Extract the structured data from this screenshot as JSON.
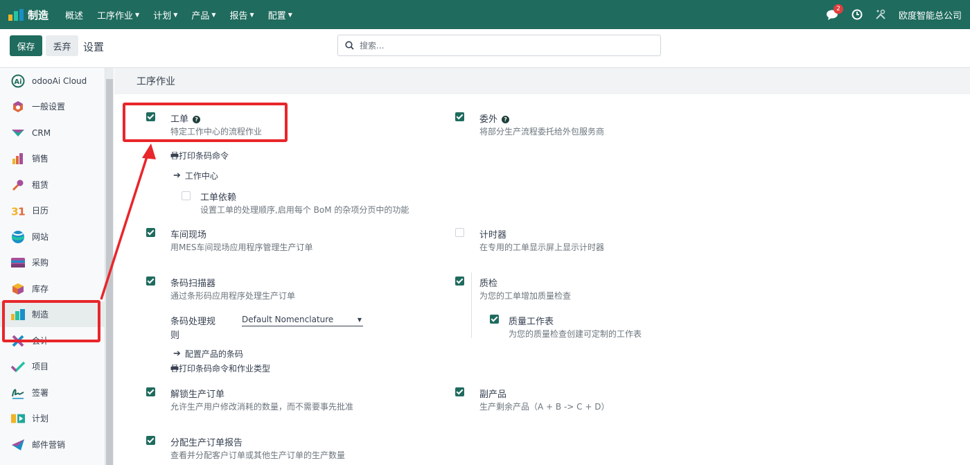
{
  "navbar": {
    "app_name": "制造",
    "menu": [
      {
        "label": "概述",
        "dropdown": false
      },
      {
        "label": "工序作业",
        "dropdown": true
      },
      {
        "label": "计划",
        "dropdown": true
      },
      {
        "label": "产品",
        "dropdown": true
      },
      {
        "label": "报告",
        "dropdown": true
      },
      {
        "label": "配置",
        "dropdown": true
      }
    ],
    "messages_count": "2",
    "company": "欧度智能总公司",
    "brand_color": "#1f6b5e"
  },
  "toolbar": {
    "save_label": "保存",
    "discard_label": "丢弃",
    "title": "设置"
  },
  "search": {
    "placeholder": "搜索..."
  },
  "sidebar": {
    "items": [
      {
        "label": "odooAi Cloud",
        "icon": "ai-cloud-icon"
      },
      {
        "label": "一般设置",
        "icon": "general-settings-icon"
      },
      {
        "label": "CRM",
        "icon": "crm-icon"
      },
      {
        "label": "销售",
        "icon": "sales-icon"
      },
      {
        "label": "租赁",
        "icon": "rental-icon"
      },
      {
        "label": "日历",
        "icon": "calendar-icon"
      },
      {
        "label": "网站",
        "icon": "website-icon"
      },
      {
        "label": "采购",
        "icon": "purchase-icon"
      },
      {
        "label": "库存",
        "icon": "inventory-icon"
      },
      {
        "label": "制造",
        "icon": "manufacturing-icon",
        "active": true
      },
      {
        "label": "会计",
        "icon": "accounting-icon"
      },
      {
        "label": "项目",
        "icon": "project-icon"
      },
      {
        "label": "签署",
        "icon": "sign-icon"
      },
      {
        "label": "计划",
        "icon": "planning-icon"
      },
      {
        "label": "邮件营销",
        "icon": "email-marketing-icon"
      }
    ]
  },
  "section": {
    "title": "工序作业"
  },
  "settings": {
    "work_orders": {
      "title": "工单",
      "desc": "特定工作中心的流程作业",
      "checked": true
    },
    "print_barcode": "打印条码命令",
    "work_centers_link": "工作中心",
    "wo_dependencies": {
      "title": "工单依赖",
      "desc": "设置工单的处理顺序,启用每个 BoM 的杂项分页中的功能",
      "checked": false
    },
    "subcontracting": {
      "title": "委外",
      "desc": "将部分生产流程委托给外包服务商",
      "checked": true
    },
    "shop_floor": {
      "title": "车间现场",
      "desc": "用MES车间现场应用程序管理生产订单",
      "checked": true
    },
    "timer": {
      "title": "计时器",
      "desc": "在专用的工单显示屏上显示计时器",
      "checked": false
    },
    "barcode_scanner": {
      "title": "条码扫描器",
      "desc": "通过条形码应用程序处理生产订单",
      "checked": true
    },
    "barcode_rule_label": "条码处理规",
    "barcode_rule_label2": "则",
    "barcode_rule_value": "Default Nomenclature",
    "config_barcodes_link": "配置产品的条码",
    "print_barcode_ops": "打印条码命令和作业类型",
    "quality": {
      "title": "质检",
      "desc": "为您的工单增加质量检查",
      "checked": true
    },
    "worksheet": {
      "title": "质量工作表",
      "desc": "为您的质量检查创建可定制的工作表",
      "checked": true
    },
    "unlock_mo": {
      "title": "解锁生产订单",
      "desc": "允许生产用户修改消耗的数量，而不需要事先批准",
      "checked": true
    },
    "byproducts": {
      "title": "副产品",
      "desc": "生产剩余产品（A + B -> C + D）",
      "checked": true
    },
    "allocation": {
      "title": "分配生产订单报告",
      "desc": "查看并分配客户订单或其他生产订单的生产数量",
      "checked": true
    }
  },
  "annotation_color": "#e8262b"
}
